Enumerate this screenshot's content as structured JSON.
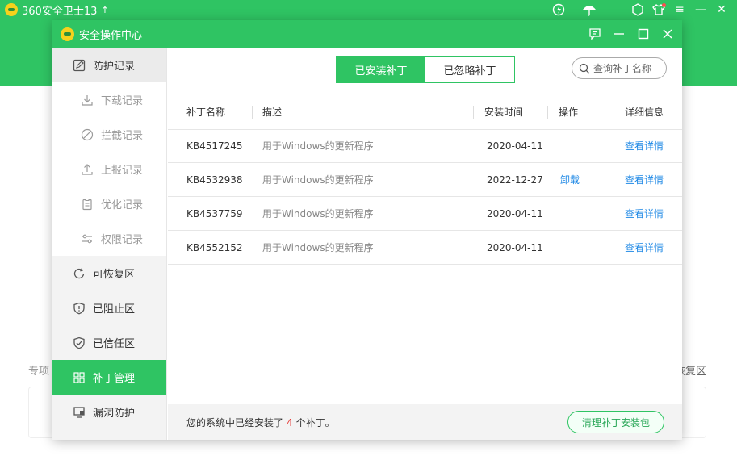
{
  "main": {
    "title": "360安全卫士13",
    "bg_left": "专项",
    "bg_right": "恢复区"
  },
  "dialog": {
    "title": "安全操作中心"
  },
  "sidebar": {
    "items": [
      {
        "label": "防护记录"
      },
      {
        "label": "下载记录"
      },
      {
        "label": "拦截记录"
      },
      {
        "label": "上报记录"
      },
      {
        "label": "优化记录"
      },
      {
        "label": "权限记录"
      },
      {
        "label": "可恢复区"
      },
      {
        "label": "已阻止区"
      },
      {
        "label": "已信任区"
      },
      {
        "label": "补丁管理"
      },
      {
        "label": "漏洞防护"
      }
    ]
  },
  "tabs": [
    {
      "label": "已安装补丁"
    },
    {
      "label": "已忽略补丁"
    }
  ],
  "search": {
    "placeholder": "查询补丁名称"
  },
  "table": {
    "headers": {
      "name": "补丁名称",
      "desc": "描述",
      "time": "安装时间",
      "op": "操作",
      "detail": "详细信息"
    },
    "rows": [
      {
        "name": "KB4517245",
        "desc": "用于Windows的更新程序",
        "time": "2020-04-11",
        "op": "",
        "detail": "查看详情"
      },
      {
        "name": "KB4532938",
        "desc": "用于Windows的更新程序",
        "time": "2022-12-27",
        "op": "卸载",
        "detail": "查看详情"
      },
      {
        "name": "KB4537759",
        "desc": "用于Windows的更新程序",
        "time": "2020-04-11",
        "op": "",
        "detail": "查看详情"
      },
      {
        "name": "KB4552152",
        "desc": "用于Windows的更新程序",
        "time": "2020-04-11",
        "op": "",
        "detail": "查看详情"
      }
    ]
  },
  "footer": {
    "prefix": "您的系统中已经安装了",
    "count": "4",
    "suffix": "个补丁。",
    "button": "清理补丁安装包"
  },
  "colors": {
    "accent": "#2fc463",
    "link": "#1e88e5",
    "count": "#e53935"
  }
}
